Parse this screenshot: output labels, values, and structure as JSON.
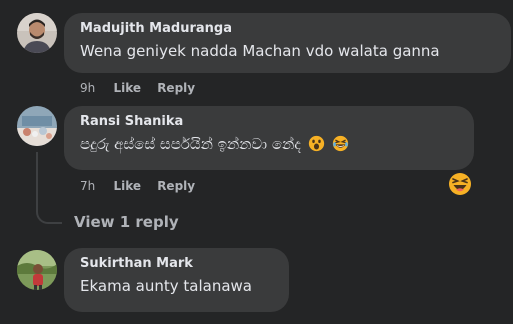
{
  "comments": [
    {
      "author": "Madujith Maduranga",
      "text": "Wena geniyek nadda Machan vdo walata ganna",
      "time": "9h",
      "like_label": "Like",
      "reply_label": "Reply"
    },
    {
      "author": "Ransi Shanika",
      "text": "පදුරු අස්සේ සර්පයින් ඉන්නවා නේද",
      "time": "7h",
      "like_label": "Like",
      "reply_label": "Reply",
      "inline_emojis": [
        "face-with-open-mouth-emoji",
        "grinning-squinting-face-emoji"
      ],
      "reaction": "haha-reaction-icon"
    },
    {
      "author": "Sukirthan Mark",
      "text": "Ekama aunty talanawa"
    }
  ],
  "view_replies_label": "View 1 reply",
  "colors": {
    "background": "#242526",
    "bubble": "#3a3b3c",
    "primary_text": "#e4e6eb",
    "secondary_text": "#b0b3b8",
    "emoji_yellow": "#f7b125"
  }
}
